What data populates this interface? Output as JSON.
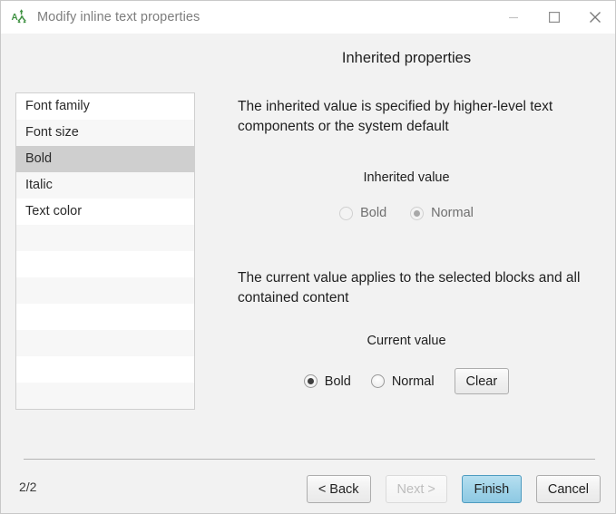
{
  "window": {
    "title": "Modify inline text properties",
    "icon": "text-properties-icon",
    "controls": {
      "minimize": "minimize-icon",
      "maximize": "maximize-icon",
      "close": "close-icon"
    }
  },
  "property_list": {
    "items": [
      {
        "label": "Font family",
        "selected": false
      },
      {
        "label": "Font size",
        "selected": false
      },
      {
        "label": "Bold",
        "selected": true
      },
      {
        "label": "Italic",
        "selected": false
      },
      {
        "label": "Text color",
        "selected": false
      },
      {
        "label": "",
        "selected": false
      },
      {
        "label": "",
        "selected": false
      },
      {
        "label": "",
        "selected": false
      },
      {
        "label": "",
        "selected": false
      },
      {
        "label": "",
        "selected": false
      },
      {
        "label": "",
        "selected": false
      },
      {
        "label": "",
        "selected": false
      }
    ]
  },
  "pane": {
    "title": "Inherited properties",
    "inherited_description": "The inherited value is specified by higher-level text components or the system default",
    "inherited_group_label": "Inherited value",
    "inherited_options": [
      {
        "label": "Bold",
        "checked": false,
        "enabled": false
      },
      {
        "label": "Normal",
        "checked": true,
        "enabled": false
      }
    ],
    "current_description": "The current value applies to the selected blocks and all contained content",
    "current_group_label": "Current value",
    "current_options": [
      {
        "label": "Bold",
        "checked": true,
        "enabled": true
      },
      {
        "label": "Normal",
        "checked": false,
        "enabled": true
      }
    ],
    "clear_label": "Clear"
  },
  "footer": {
    "page_indicator": "2/2",
    "back_label": "< Back",
    "next_label": "Next >",
    "finish_label": "Finish",
    "cancel_label": "Cancel"
  },
  "colors": {
    "window_background": "#f2f2f2",
    "titlebar_background": "#ffffff",
    "title_text": "#7d7d7d",
    "list_selected": "#cfcfcf",
    "list_alt_row": "#f7f7f7",
    "primary_button": "#9ed2e8",
    "primary_button_border": "#4f9cc0",
    "icon_green": "#3f9142",
    "separator": "#b3b3b3"
  }
}
